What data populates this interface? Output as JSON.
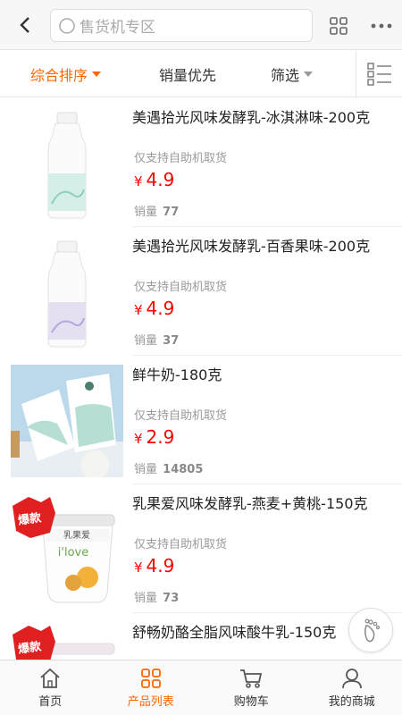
{
  "header": {
    "search_placeholder": "售货机专区"
  },
  "sortbar": {
    "items": [
      {
        "label": "综合排序",
        "active": true
      },
      {
        "label": "销量优先",
        "active": false
      },
      {
        "label": "筛选",
        "active": false
      }
    ]
  },
  "products": [
    {
      "name": "美遇拾光风味发酵乳-冰淇淋味-200克",
      "note": "仅支持自助机取货",
      "currency": "¥",
      "price": "4.9",
      "sales_label": "销量",
      "sales": "77",
      "badge": "",
      "thumb": "bottle-green"
    },
    {
      "name": "美遇拾光风味发酵乳-百香果味-200克",
      "note": "仅支持自助机取货",
      "currency": "¥",
      "price": "4.9",
      "sales_label": "销量",
      "sales": "37",
      "badge": "",
      "thumb": "bottle-purple"
    },
    {
      "name": "鲜牛奶-180克",
      "note": "仅支持自助机取货",
      "currency": "¥",
      "price": "2.9",
      "sales_label": "销量",
      "sales": "14805",
      "badge": "",
      "thumb": "milk-pouch"
    },
    {
      "name": "乳果爱风味发酵乳-燕麦+黄桃-150克",
      "note": "仅支持自助机取货",
      "currency": "¥",
      "price": "4.9",
      "sales_label": "销量",
      "sales": "73",
      "badge": "爆款",
      "thumb": "yogurt-cup",
      "cup_brand": "乳果爱",
      "cup_text": "i'love"
    },
    {
      "name": "舒畅奶酪全脂风味酸牛乳-150克",
      "note": "",
      "currency": "",
      "price": "",
      "sales_label": "",
      "sales": "",
      "badge": "爆款",
      "thumb": "yogurt-cup-2"
    }
  ],
  "tabbar": {
    "items": [
      {
        "label": "首页",
        "icon": "home-icon",
        "active": false
      },
      {
        "label": "产品列表",
        "icon": "grid-icon",
        "active": true
      },
      {
        "label": "购物车",
        "icon": "cart-icon",
        "active": false
      },
      {
        "label": "我的商城",
        "icon": "user-icon",
        "active": false
      }
    ]
  },
  "colors": {
    "accent": "#ff6600",
    "price": "#ff0000"
  }
}
